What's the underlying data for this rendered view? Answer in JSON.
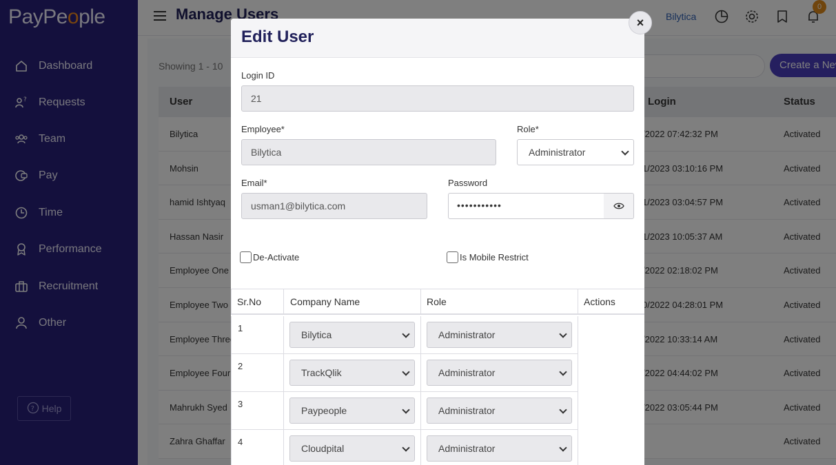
{
  "brand": {
    "logo_prefix": "PayPe",
    "logo_o": "o",
    "logo_suffix": "ple"
  },
  "sidebar": {
    "items": [
      {
        "label": "Dashboard",
        "icon": "home-icon"
      },
      {
        "label": "Requests",
        "icon": "requests-icon"
      },
      {
        "label": "Team",
        "icon": "team-icon"
      },
      {
        "label": "Pay",
        "icon": "pay-icon"
      },
      {
        "label": "Time",
        "icon": "clock-icon"
      },
      {
        "label": "Performance",
        "icon": "award-icon"
      },
      {
        "label": "Recruitment",
        "icon": "briefcase-icon"
      },
      {
        "label": "Other",
        "icon": "user-icon"
      }
    ],
    "help": "Help"
  },
  "header": {
    "title": "Manage Users",
    "company": "Bilytica",
    "notification_count": "0"
  },
  "list": {
    "showing": "Showing 1 - 10",
    "create_button": "Create a New User",
    "columns": {
      "user": "User",
      "login": "Login",
      "status": "Status"
    },
    "rows": [
      {
        "user": "Bilytica",
        "login": "/2022 07:42:32 PM",
        "status": "Activated"
      },
      {
        "user": "Mohsin",
        "login": "1/2023 03:10:16 PM",
        "status": "Activated"
      },
      {
        "user": "hamid Ishtyaq",
        "login": "1/2023 03:04:57 PM",
        "status": "Activated"
      },
      {
        "user": "Hassan Nasir",
        "login": "1/2023 10:05:37 AM",
        "status": "Activated"
      },
      {
        "user": "Employee One",
        "login": "/2022 02:18:02 PM",
        "status": "Activated"
      },
      {
        "user": "Employee Two",
        "login": "0/2022 04:28:01 PM",
        "status": "Activated"
      },
      {
        "user": "Employee Three",
        "login": "/2022 10:33:14 AM",
        "status": "Activated"
      },
      {
        "user": "Employee Four",
        "login": "/2022 04:44:02 PM",
        "status": "Activated"
      },
      {
        "user": "Mahrukh Syed",
        "login": "/2022 03:05:44 PM",
        "status": "Activated"
      },
      {
        "user": "Zahra Ghaffar",
        "login": "",
        "status": "Activated"
      }
    ]
  },
  "modal": {
    "title": "Edit User",
    "close": "×",
    "login_id_label": "Login ID",
    "login_id_value": "21",
    "employee_label": "Employee*",
    "employee_value": "Bilytica",
    "role_label": "Role*",
    "role_value": "Administrator",
    "email_label": "Email*",
    "email_value": "usman1@bilytica.com",
    "password_label": "Password",
    "password_value": "•••••••••••",
    "deactivate_label": "De-Activate",
    "mobile_restrict_label": "Is Mobile Restrict",
    "table": {
      "headers": {
        "srno": "Sr.No",
        "company": "Company Name",
        "role": "Role",
        "actions": "Actions"
      },
      "rows": [
        {
          "no": "1",
          "company": "Bilytica",
          "role": "Administrator"
        },
        {
          "no": "2",
          "company": "TrackQlik",
          "role": "Administrator"
        },
        {
          "no": "3",
          "company": "Paypeople",
          "role": "Administrator"
        },
        {
          "no": "4",
          "company": "Cloudpital",
          "role": "Administrator"
        }
      ]
    }
  },
  "colors": {
    "sidebar": "#29217a",
    "accent": "#4a3fbf",
    "logo_accent": "#f28a1e",
    "title": "#20205a"
  }
}
